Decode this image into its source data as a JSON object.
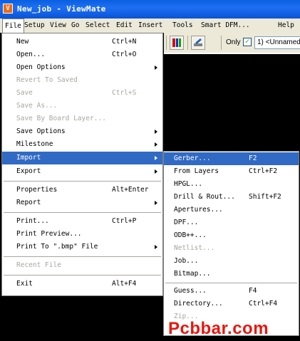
{
  "window": {
    "title": "New_job - ViewMate"
  },
  "menubar": {
    "items": [
      {
        "label": "File",
        "open": true
      },
      {
        "label": "Setup"
      },
      {
        "label": "View"
      },
      {
        "label": "Go"
      },
      {
        "label": "Select"
      },
      {
        "label": "Edit"
      },
      {
        "label": "Insert"
      },
      {
        "label": "Tools"
      },
      {
        "label": "Smart DFM..."
      },
      {
        "label": "Help"
      }
    ]
  },
  "toolbar": {
    "only_label": "Only",
    "only_checked": true,
    "layer_value": "1) <Unnamed"
  },
  "file_menu": {
    "items": [
      {
        "label": "New",
        "shortcut": "Ctrl+N"
      },
      {
        "label": "Open...",
        "shortcut": "Ctrl+O"
      },
      {
        "label": "Open Options",
        "submenu": true
      },
      {
        "label": "Revert To Saved",
        "disabled": true
      },
      {
        "label": "Save",
        "shortcut": "Ctrl+S",
        "disabled": true
      },
      {
        "label": "Save As...",
        "disabled": true
      },
      {
        "label": "Save By Board Layer...",
        "disabled": true
      },
      {
        "label": "Save Options",
        "submenu": true
      },
      {
        "label": "Milestone",
        "submenu": true
      },
      {
        "label": "Import",
        "submenu": true,
        "highlighted": true
      },
      {
        "label": "Export",
        "submenu": true
      },
      {
        "label": "Properties",
        "shortcut": "Alt+Enter"
      },
      {
        "label": "Report",
        "submenu": true
      },
      {
        "label": "Print...",
        "shortcut": "Ctrl+P"
      },
      {
        "label": "Print Preview..."
      },
      {
        "label": "Print To \".bmp\" File",
        "submenu": true
      },
      {
        "label": "Recent File",
        "disabled": true
      },
      {
        "label": "Exit",
        "shortcut": "Alt+F4"
      }
    ]
  },
  "import_menu": {
    "items": [
      {
        "label": "Gerber...",
        "shortcut": "F2",
        "highlighted": true
      },
      {
        "label": "From Layers",
        "shortcut": "Ctrl+F2"
      },
      {
        "label": "HPGL..."
      },
      {
        "label": "Drill & Rout...",
        "shortcut": "Shift+F2"
      },
      {
        "label": "Apertures..."
      },
      {
        "label": "DPF..."
      },
      {
        "label": "ODB++..."
      },
      {
        "label": "Netlist...",
        "disabled": true
      },
      {
        "label": "Job..."
      },
      {
        "label": "Bitmap..."
      },
      {
        "label": "Guess...",
        "shortcut": "F4"
      },
      {
        "label": "Directory...",
        "shortcut": "Ctrl+F4"
      },
      {
        "label": "Zip...",
        "disabled": true
      }
    ]
  },
  "watermark": "Pcbbar.com",
  "colors": {
    "highlight": "#316ac5",
    "titlebar": "#0a5fe0",
    "watermark": "#e8170f"
  },
  "icons": [
    "viewmate-app-icon",
    "layer-colors-icon",
    "edit-tool-icon"
  ]
}
